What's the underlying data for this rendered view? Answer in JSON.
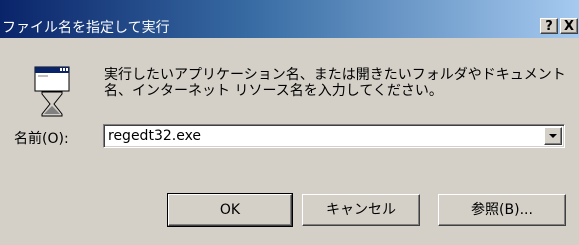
{
  "window": {
    "title": "ファイル名を指定して実行",
    "help_button": "?",
    "close_button": "X"
  },
  "dialog": {
    "description": "実行したいアプリケーション名、または開きたいフォルダやドキュメント\n名、インターネット リソース名を入力してください。",
    "name_label": "名前(O):",
    "name_value": "regedt32.exe"
  },
  "buttons": {
    "ok": "OK",
    "cancel": "キャンセル",
    "browse": "参照(B)..."
  },
  "icons": [
    "run-icon",
    "dropdown-arrow-icon",
    "help-icon",
    "close-icon"
  ],
  "colors": {
    "title_start": "#0a246a",
    "title_end": "#a6caf0",
    "face": "#d4d0c8"
  }
}
